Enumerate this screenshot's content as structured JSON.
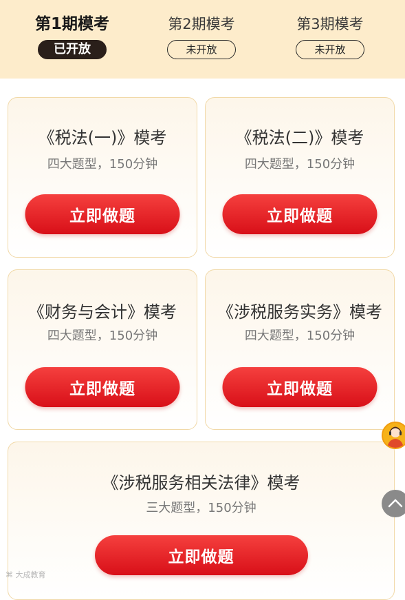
{
  "periods": [
    {
      "title": "第1期模考",
      "status": "已开放",
      "active": true
    },
    {
      "title": "第2期模考",
      "status": "未开放",
      "active": false
    },
    {
      "title": "第3期模考",
      "status": "未开放",
      "active": false
    }
  ],
  "exams": [
    {
      "title": "《税法(一)》模考",
      "subtitle": "四大题型，150分钟",
      "button": "立即做题"
    },
    {
      "title": "《税法(二)》模考",
      "subtitle": "四大题型，150分钟",
      "button": "立即做题"
    },
    {
      "title": "《财务与会计》模考",
      "subtitle": "四大题型，150分钟",
      "button": "立即做题"
    },
    {
      "title": "《涉税服务实务》模考",
      "subtitle": "四大题型，150分钟",
      "button": "立即做题"
    },
    {
      "title": "《涉税服务相关法律》模考",
      "subtitle": "三大题型，150分钟",
      "button": "立即做题"
    }
  ],
  "floating": {
    "avatar_icon": "customer-service-avatar-icon",
    "top_icon": "chevron-up-icon"
  },
  "watermark": "大成教育",
  "colors": {
    "accent": "#e3141c",
    "header_bg": "#fdeccb",
    "badge_dark": "#2a1f1a"
  }
}
